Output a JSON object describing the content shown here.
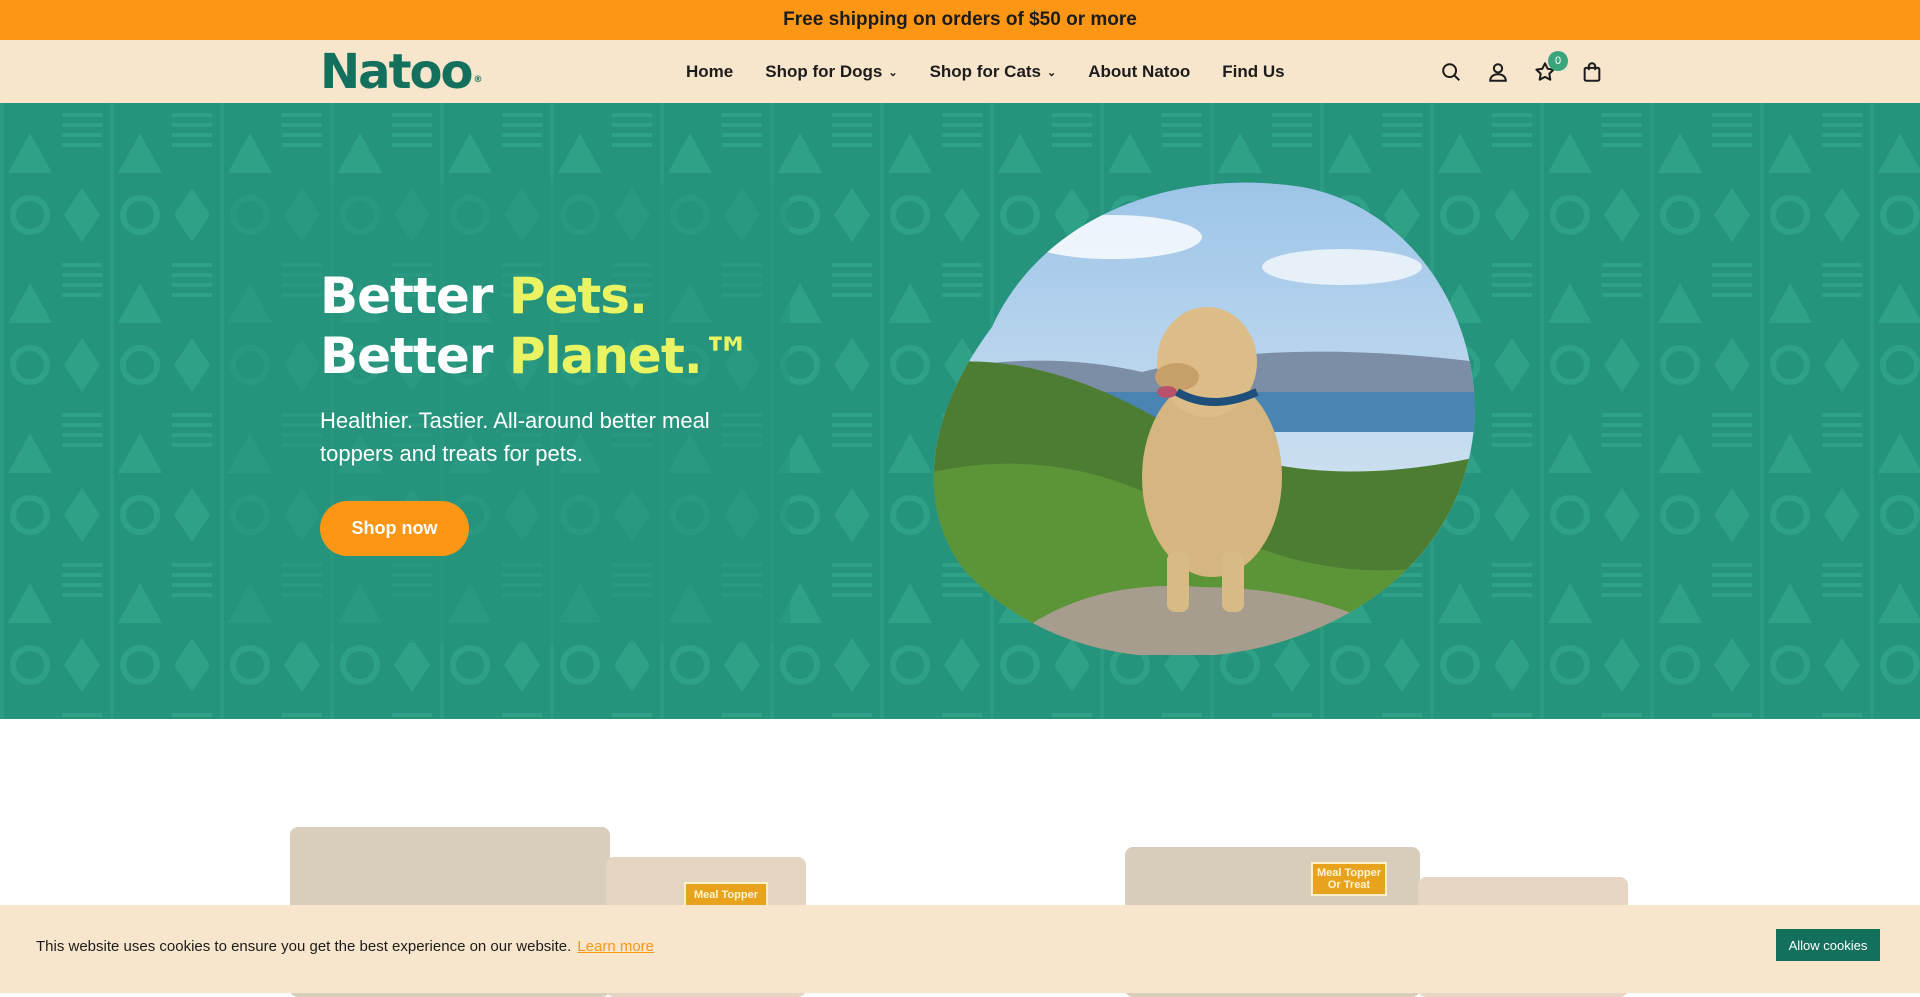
{
  "announcement": {
    "text": "Free shipping on orders of $50 or more"
  },
  "header": {
    "logo": "Natoo",
    "logo_mark": "®",
    "nav": [
      {
        "label": "Home",
        "dropdown": false
      },
      {
        "label": "Shop for Dogs",
        "dropdown": true
      },
      {
        "label": "Shop for Cats",
        "dropdown": true
      },
      {
        "label": "About Natoo",
        "dropdown": false
      },
      {
        "label": "Find Us",
        "dropdown": false
      }
    ],
    "icons": [
      "search-icon",
      "account-icon",
      "wishlist-icon",
      "cart-icon"
    ],
    "wishlist_count": "0"
  },
  "hero": {
    "line1_white": "Better ",
    "line1_highlight": "Pets.",
    "line2_white": "Better ",
    "line2_highlight": "Planet.™",
    "subtext": "Healthier. Tastier. All-around better meal toppers and treats for pets.",
    "cta": "Shop now",
    "image_alt": "terrier dog sitting on a hilltop"
  },
  "products": {
    "tag_left": "Meal Topper",
    "tag_right": "Meal Topper Or Treat"
  },
  "cookie": {
    "message": "This website uses cookies to ensure you get the best experience on our website.",
    "learn_more": "Learn more",
    "accept": "Allow cookies"
  },
  "colors": {
    "announce_bg": "#fd9515",
    "header_bg": "#f7e5cc",
    "brand_green": "#12705c",
    "hero_teal": "#26947c",
    "highlight_yellow": "#eaf463",
    "cta_orange": "#fd9515"
  }
}
